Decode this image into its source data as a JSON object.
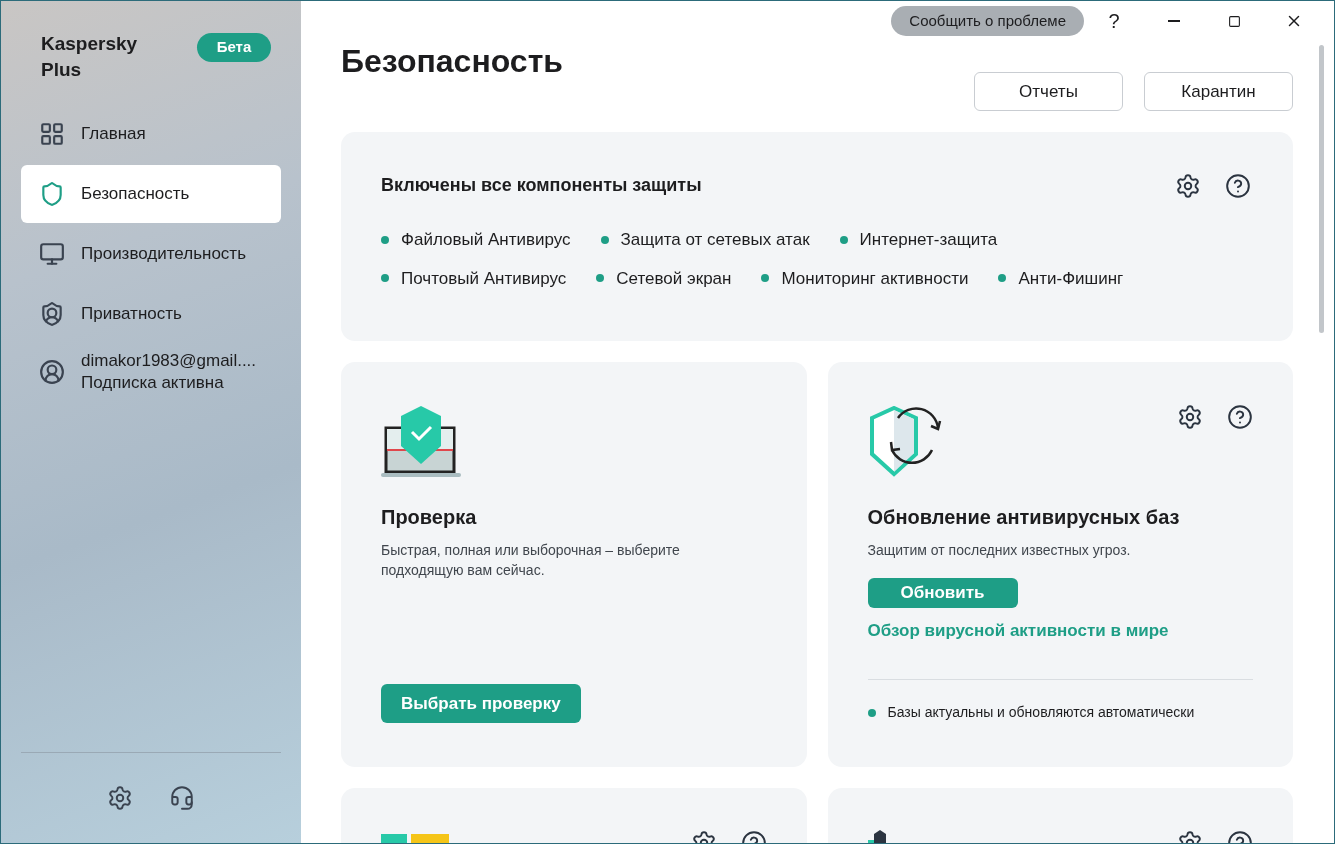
{
  "sidebar": {
    "app_name": "Kaspersky Plus",
    "badge": "Бета",
    "items": [
      {
        "kind": "home",
        "label": "Главная",
        "selected": false
      },
      {
        "kind": "shield",
        "label": "Безопасность",
        "selected": true
      },
      {
        "kind": "monitor",
        "label": "Производительность",
        "selected": false
      },
      {
        "kind": "privacy",
        "label": "Приватность",
        "selected": false
      }
    ],
    "account": {
      "email": "dimakor1983@gmail....",
      "status": "Подписка активна"
    }
  },
  "titlebar": {
    "report_button": "Сообщить о проблеме",
    "help": "?"
  },
  "page": {
    "title": "Безопасность",
    "buttons": [
      "Отчеты",
      "Карантин"
    ]
  },
  "protection": {
    "title": "Включены все компоненты защиты",
    "rows": [
      [
        "Файловый Антивирус",
        "Защита от сетевых атак",
        "Интернет-защита"
      ],
      [
        "Почтовый Антивирус",
        "Сетевой экран",
        "Мониторинг активности",
        "Анти-Фишинг"
      ]
    ]
  },
  "cards": [
    {
      "kind": "scan",
      "title": "Проверка",
      "description": "Быстрая, полная или выборочная – выберите подходящую вам сейчас.",
      "button": "Выбрать проверку"
    },
    {
      "kind": "update",
      "title": "Обновление антивирусных баз",
      "description": "Защитим от последних известных угроз.",
      "button": "Обновить",
      "link": "Обзор вирусной активности в мире",
      "status": "Базы актуальны и обновляются автоматически"
    }
  ]
}
